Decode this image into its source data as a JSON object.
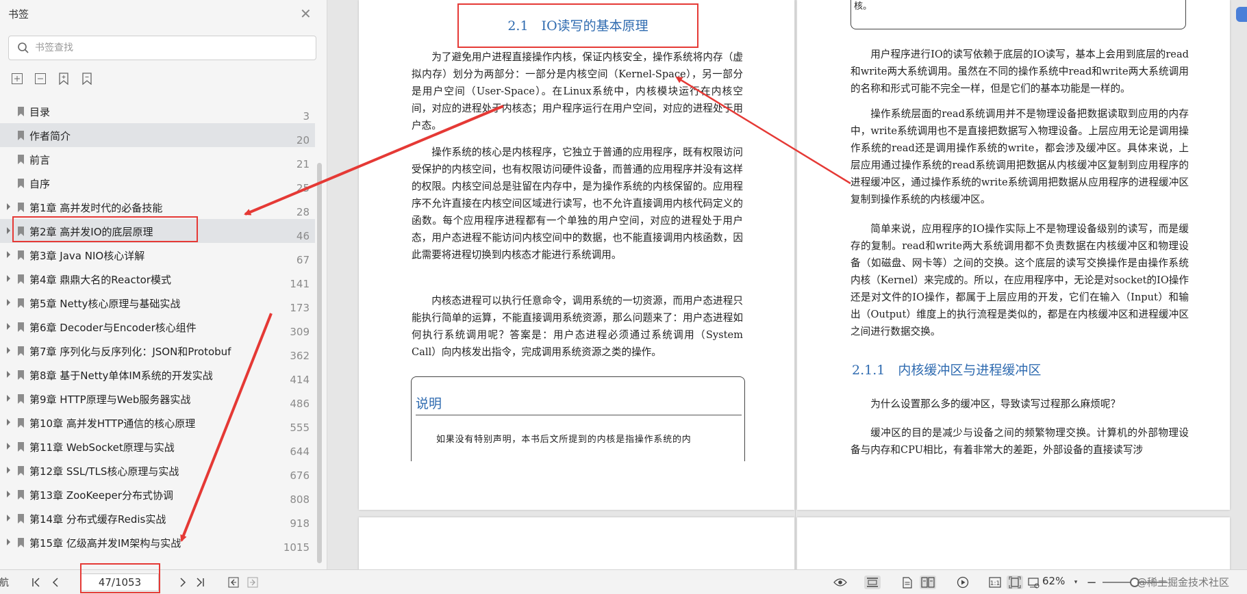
{
  "sidebar": {
    "title": "书签",
    "search_placeholder": "书签查找",
    "items": [
      {
        "label": "目录",
        "page": "3",
        "expandable": false
      },
      {
        "label": "作者简介",
        "page": "20",
        "expandable": false
      },
      {
        "label": "前言",
        "page": "21",
        "expandable": false
      },
      {
        "label": "自序",
        "page": "25",
        "expandable": false
      },
      {
        "label": "第1章 高并发时代的必备技能",
        "page": "28",
        "expandable": true
      },
      {
        "label": "第2章 高并发IO的底层原理",
        "page": "46",
        "expandable": true
      },
      {
        "label": "第3章 Java NIO核心详解",
        "page": "67",
        "expandable": true
      },
      {
        "label": "第4章 鼎鼎大名的Reactor模式",
        "page": "141",
        "expandable": true
      },
      {
        "label": "第5章 Netty核心原理与基础实战",
        "page": "173",
        "expandable": true
      },
      {
        "label": "第6章 Decoder与Encoder核心组件",
        "page": "309",
        "expandable": true
      },
      {
        "label": "第7章 序列化与反序列化：JSON和Protobuf",
        "page": "362",
        "expandable": true
      },
      {
        "label": "第8章 基于Netty单体IM系统的开发实战",
        "page": "414",
        "expandable": true
      },
      {
        "label": "第9章 HTTP原理与Web服务器实战",
        "page": "486",
        "expandable": true
      },
      {
        "label": "第10章 高并发HTTP通信的核心原理",
        "page": "555",
        "expandable": true
      },
      {
        "label": "第11章 WebSocket原理与实战",
        "page": "644",
        "expandable": true
      },
      {
        "label": "第12章 SSL/TLS核心原理与实战",
        "page": "676",
        "expandable": true
      },
      {
        "label": "第13章 ZooKeeper分布式协调",
        "page": "808",
        "expandable": true
      },
      {
        "label": "第14章 分布式缓存Redis实战",
        "page": "918",
        "expandable": true
      },
      {
        "label": "第15章 亿级高并发IM架构与实战",
        "page": "1015",
        "expandable": true
      }
    ]
  },
  "document": {
    "left_page": {
      "section_title": "2.1　IO读写的基本原理",
      "paragraphs": [
        "为了避免用户进程直接操作内核，保证内核安全，操作系统将内存（虚拟内存）划分为两部分：一部分是内核空间（Kernel-Space），另一部分是用户空间（User-Space）。在Linux系统中，内核模块运行在内核空间，对应的进程处于内核态；用户程序运行在用户空间，对应的进程处于用户态。",
        "操作系统的核心是内核程序，它独立于普通的应用程序，既有权限访问受保护的内核空间，也有权限访问硬件设备，而普通的应用程序并没有这样的权限。内核空间总是驻留在内存中，是为操作系统的内核保留的。应用程序不允许直接在内核空间区域进行读写，也不允许直接调用内核代码定义的函数。每个应用程序进程都有一个单独的用户空间，对应的进程处于用户态，用户态进程不能访问内核空间中的数据，也不能直接调用内核函数，因此需要将进程切换到内核态才能进行系统调用。",
        "内核态进程可以执行任意命令，调用系统的一切资源，而用户态进程只能执行简单的运算，不能直接调用系统资源，那么问题来了：用户态进程如何执行系统调用呢？答案是：用户态进程必须通过系统调用（System Call）向内核发出指令，完成调用系统资源之类的操作。"
      ],
      "note_title": "说明",
      "note_text": "如果没有特别声明，本书后文所提到的内核是指操作系统的内"
    },
    "right_page": {
      "note_tail": "核。",
      "paragraphs": [
        "用户程序进行IO的读写依赖于底层的IO读写，基本上会用到底层的read和write两大系统调用。虽然在不同的操作系统中read和write两大系统调用的名称和形式可能不完全一样，但是它们的基本功能是一样的。",
        "操作系统层面的read系统调用并不是物理设备把数据读取到应用的内存中，write系统调用也不是直接把数据写入物理设备。上层应用无论是调用操作系统的read还是调用操作系统的write，都会涉及缓冲区。具体来说，上层应用通过操作系统的read系统调用把数据从内核缓冲区复制到应用程序的进程缓冲区，通过操作系统的write系统调用把数据从应用程序的进程缓冲区复制到操作系统的内核缓冲区。",
        "简单来说，应用程序的IO操作实际上不是物理设备级别的读写，而是缓存的复制。read和write两大系统调用都不负责数据在内核缓冲区和物理设备（如磁盘、网卡等）之间的交换。这个底层的读写交换操作是由操作系统内核（Kernel）来完成的。所以，在应用程序中，无论是对socket的IO操作还是对文件的IO操作，都属于上层应用的开发，它们在输入（Input）和输出（Output）维度上的执行流程是类似的，都是在内核缓冲区和进程缓冲区之间进行数据交换。",
        "为什么设置那么多的缓冲区，导致读写过程那么麻烦呢？",
        "缓冲区的目的是减少与设备之间的频繁物理交换。计算机的外部物理设备与内存和CPU相比，有着非常大的差距，外部设备的直接读写涉"
      ],
      "subsection_title": "2.1.1　内核缓冲区与进程缓冲区"
    }
  },
  "statusbar": {
    "left_fragment": "航",
    "page_indicator": "47/1053",
    "zoom": "62%",
    "watermark": "@稀土掘金技术社区"
  },
  "colors": {
    "annotation_red": "#e53935",
    "heading_blue": "#2f6bb0",
    "sidebar_highlight": "#e1e3e6"
  }
}
